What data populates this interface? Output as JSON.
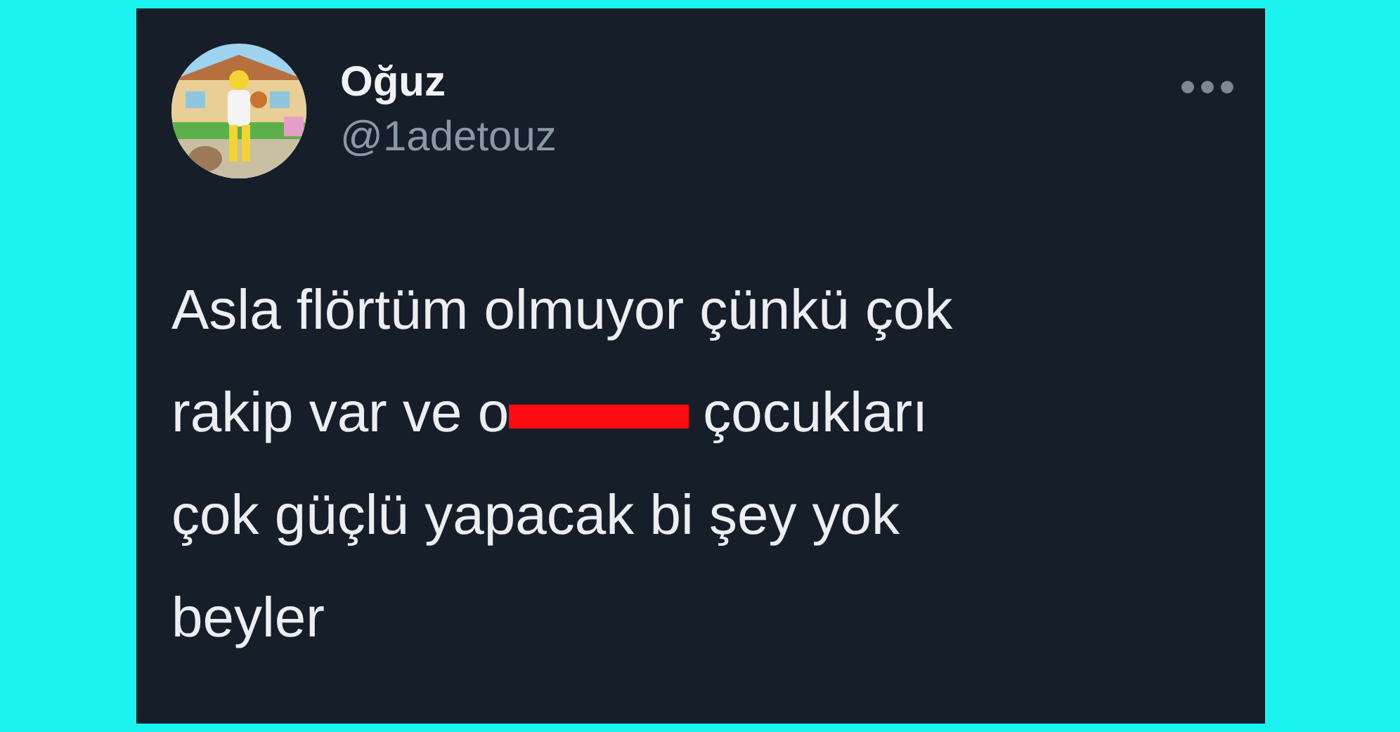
{
  "author": {
    "name": "Oğuz",
    "handle": "@1adetouz"
  },
  "body_lines": [
    {
      "segments": [
        {
          "kind": "text",
          "text": "Asla flörtüm olmuyor çünkü çok"
        }
      ]
    },
    {
      "segments": [
        {
          "kind": "text",
          "text": "rakip var ve o"
        },
        {
          "kind": "censor"
        },
        {
          "kind": "text",
          "text": "çocukları"
        }
      ]
    },
    {
      "segments": [
        {
          "kind": "text",
          "text": "çok güçlü yapacak bi şey yok"
        }
      ]
    },
    {
      "segments": [
        {
          "kind": "text",
          "text": "beyler"
        }
      ]
    }
  ]
}
